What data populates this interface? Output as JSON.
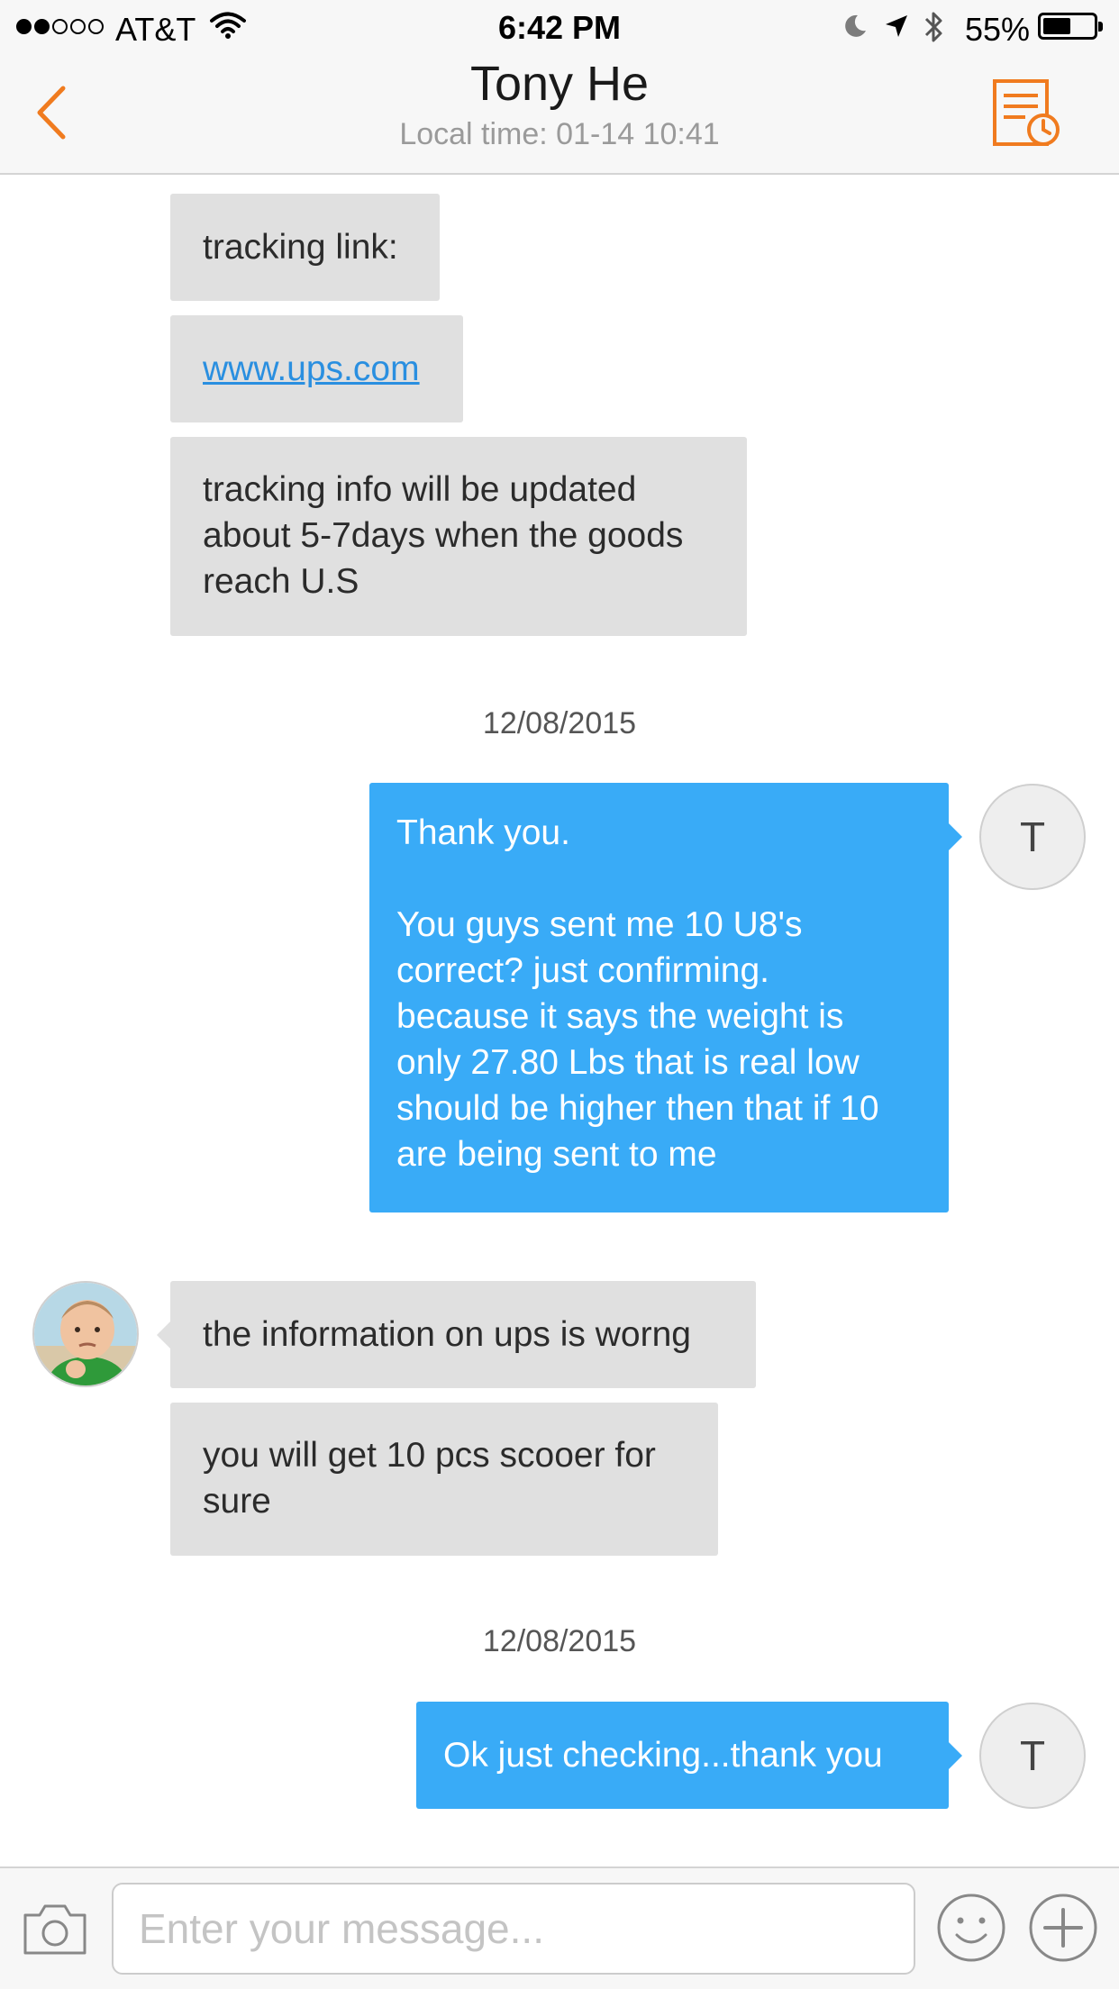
{
  "status_bar": {
    "carrier": "AT&T",
    "time": "6:42 PM",
    "battery_percent": "55%",
    "battery_level": 0.55,
    "signal_bars": 2,
    "signal_total": 5,
    "icons": [
      "signal-dots-icon",
      "wifi-icon",
      "moon-icon",
      "location-arrow-icon",
      "bluetooth-icon",
      "battery-icon"
    ]
  },
  "header": {
    "title": "Tony He",
    "subtitle": "Local time: 01-14 10:41",
    "back_icon": "chevron-left-icon",
    "history_icon": "order-history-icon"
  },
  "colors": {
    "accent": "#f07b1f",
    "outgoing_bubble": "#39abf7",
    "incoming_bubble": "#e0e0e0",
    "link": "#2a8fe0"
  },
  "conversation": {
    "partial_bubble_text": "",
    "incoming_block_1": [
      {
        "text": "tracking link:"
      },
      {
        "text": "www.ups.com"
      },
      {
        "text": "tracking info will be updated\nabout 5-7days when the goods\nreach U.S"
      }
    ],
    "date_1": "12/08/2015",
    "outgoing_1": {
      "text": "Thank you.\n\nYou guys sent me 10 U8's\ncorrect? just confirming.\nbecause it says the weight is\nonly 27.80 Lbs that is real low\nshould be higher then that if 10\nare being sent to me",
      "avatar_letter": "T"
    },
    "incoming_block_2": [
      {
        "text": "the information on ups is worng"
      },
      {
        "text": "you will get 10 pcs scooer for\nsure"
      }
    ],
    "date_2": "12/08/2015",
    "outgoing_2": {
      "text": "Ok just checking...thank you",
      "avatar_letter": "T"
    }
  },
  "input_bar": {
    "placeholder": "Enter your message...",
    "value": "",
    "camera_icon": "camera-icon",
    "emoji_icon": "smiley-icon",
    "plus_icon": "plus-circle-icon"
  }
}
